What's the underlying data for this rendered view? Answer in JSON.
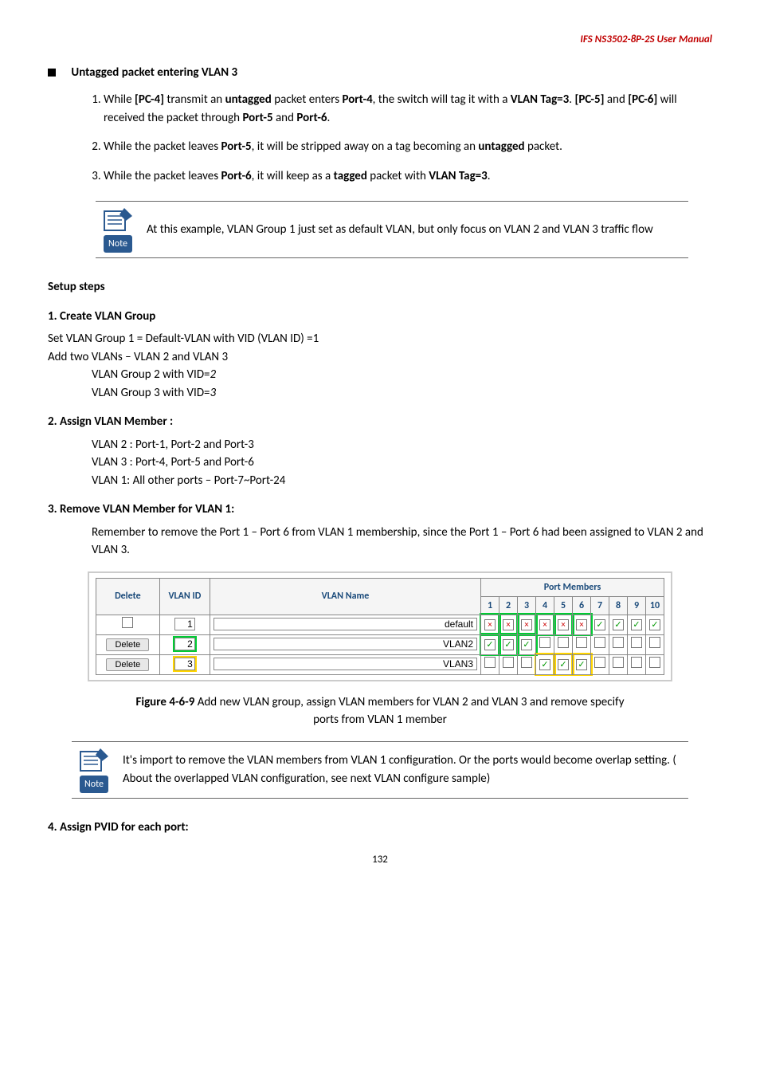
{
  "header": "IFS  NS3502-8P-2S  User  Manual",
  "title1": "Untagged packet entering VLAN 3",
  "list": {
    "i1": "While [PC-4] transmit an untagged packet enters Port-4, the switch will tag it with a VLAN Tag=3. [PC-5] and [PC-6] will received the packet through Port-5 and Port-6.",
    "i2": "While the packet leaves Port-5, it will be stripped away on a tag becoming an untagged packet.",
    "i3": "While the packet leaves Port-6, it will keep as a tagged packet with VLAN Tag=3."
  },
  "note1": "At this example, VLAN Group 1 just set as default VLAN, but only focus on VLAN 2 and VLAN 3 traffic flow",
  "noteLabel": "Note",
  "setup": {
    "heading": "Setup steps",
    "s1": "1.  Create VLAN Group",
    "s1a": "Set VLAN Group 1 = Default-VLAN with VID (VLAN ID) =1",
    "s1b": "Add two VLANs – VLAN 2 and VLAN 3",
    "s1c": "VLAN Group 2 with VID=2",
    "s1d": "VLAN Group 3 with VID=3",
    "s2": "2.  Assign VLAN Member :",
    "s2a": "VLAN 2 : Port-1, Port-2 and Port-3",
    "s2b": "VLAN 3 : Port-4, Port-5 and Port-6",
    "s2c": "VLAN 1: All other ports – Port-7~Port-24",
    "s3": "3.  Remove VLAN Member for VLAN 1:",
    "s3a": "Remember to remove the Port 1 – Port 6 from VLAN 1 membership, since the Port 1 – Port 6 had been assigned to VLAN 2 and VLAN 3."
  },
  "table": {
    "pmHeader": "Port Members",
    "cols": {
      "del": "Delete",
      "vid": "VLAN ID",
      "name": "VLAN Name"
    },
    "ports": [
      "1",
      "2",
      "3",
      "4",
      "5",
      "6",
      "7",
      "8",
      "9",
      "10"
    ],
    "deleteBtn": "Delete",
    "rows": [
      {
        "vid": "1",
        "name": "default",
        "highlight": "none",
        "members": [
          "x",
          "x",
          "x",
          "x",
          "x",
          "x",
          "v",
          "v",
          "v",
          "v"
        ],
        "memHl": [
          0,
          1,
          2,
          3,
          4,
          5
        ]
      },
      {
        "vid": "2",
        "name": "VLAN2",
        "highlight": "green",
        "members": [
          "v",
          "v",
          "v",
          "",
          "",
          "",
          "",
          "",
          "",
          ""
        ],
        "memHl": [
          0,
          1,
          2
        ]
      },
      {
        "vid": "3",
        "name": "VLAN3",
        "highlight": "yellow",
        "members": [
          "",
          "",
          "",
          "v",
          "v",
          "v",
          "",
          "",
          "",
          ""
        ],
        "memHl": [
          3,
          4,
          5
        ]
      }
    ]
  },
  "figure": {
    "captionA": "Figure 4-6-9 Add new VLAN group, assign VLAN members for VLAN 2 and VLAN 3 and remove specify",
    "captionB": "ports from VLAN 1 member"
  },
  "note2": "It's import to remove the VLAN members from VLAN 1 configuration. Or the ports would become overlap setting. ( About the overlapped VLAN configuration, see next VLAN configure sample)",
  "s4": "4.  Assign PVID for each port:",
  "page": "132"
}
